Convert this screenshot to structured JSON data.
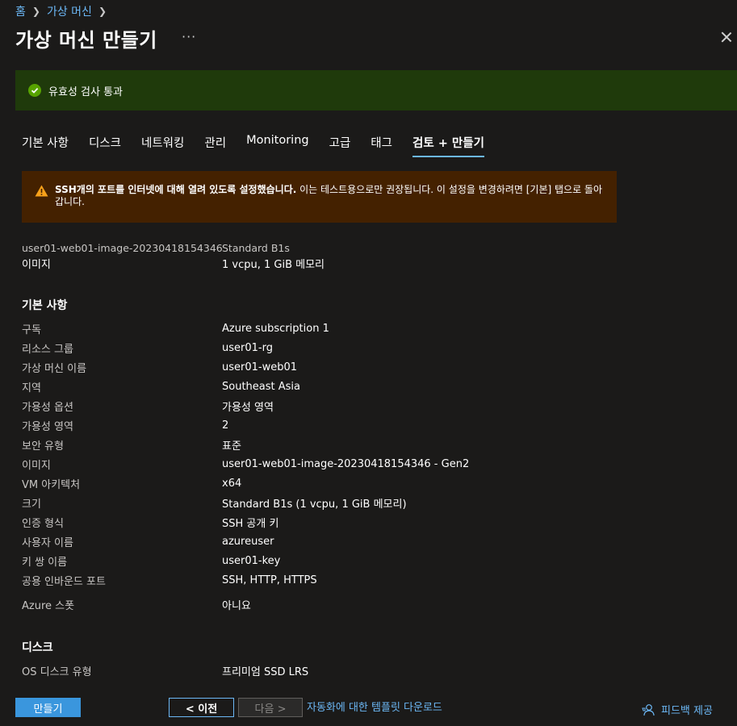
{
  "breadcrumb": {
    "home": "홈",
    "vm": "가상 머신"
  },
  "page": {
    "title": "가상 머신 만들기",
    "more": "···"
  },
  "validation": {
    "text": "유효성 검사 통과"
  },
  "tabs": [
    "기본 사항",
    "디스크",
    "네트워킹",
    "관리",
    "Monitoring",
    "고급",
    "태그",
    "검토 + 만들기"
  ],
  "warning": {
    "bold": "SSH개의 포트를 인터넷에 대해 열려 있도록 설정했습니다.",
    "rest": " 이는 테스트용으로만 권장됩니다. 이 설정을 변경하려면 [기본] 탭으로 돌아갑니다."
  },
  "summary": {
    "image_name": "user01-web01-image-20230418154346",
    "image_label": "이미지",
    "size_name": "Standard B1s",
    "size_detail": "1 vcpu, 1 GiB 메모리"
  },
  "basics": {
    "title": "기본 사항",
    "rows": [
      {
        "k": "구독",
        "v": "Azure subscription 1"
      },
      {
        "k": "리소스 그룹",
        "v": "user01-rg"
      },
      {
        "k": "가상 머신 이름",
        "v": "user01-web01"
      },
      {
        "k": "지역",
        "v": "Southeast Asia"
      },
      {
        "k": "가용성 옵션",
        "v": "가용성 영역"
      },
      {
        "k": "가용성 영역",
        "v": "2"
      },
      {
        "k": "보안 유형",
        "v": "표준"
      },
      {
        "k": "이미지",
        "v": "user01-web01-image-20230418154346 - Gen2"
      },
      {
        "k": "VM 아키텍처",
        "v": "x64"
      },
      {
        "k": "크기",
        "v": "Standard B1s (1 vcpu, 1 GiB 메모리)"
      },
      {
        "k": "인증 형식",
        "v": "SSH 공개 키"
      },
      {
        "k": "사용자 이름",
        "v": "azureuser"
      },
      {
        "k": "키 쌍 이름",
        "v": "user01-key"
      },
      {
        "k": "공용 인바운드 포트",
        "v": "SSH, HTTP, HTTPS"
      }
    ],
    "spot": {
      "k": "Azure 스폿",
      "v": "아니요"
    }
  },
  "disks": {
    "title": "디스크",
    "rows": [
      {
        "k": "OS 디스크 유형",
        "v": "프리미엄 SSD LRS"
      }
    ]
  },
  "footer": {
    "create": "만들기",
    "prev": "< 이전",
    "next": "다음 >",
    "download": "자동화에 대한 템플릿 다운로드",
    "feedback": "피드백 제공"
  }
}
